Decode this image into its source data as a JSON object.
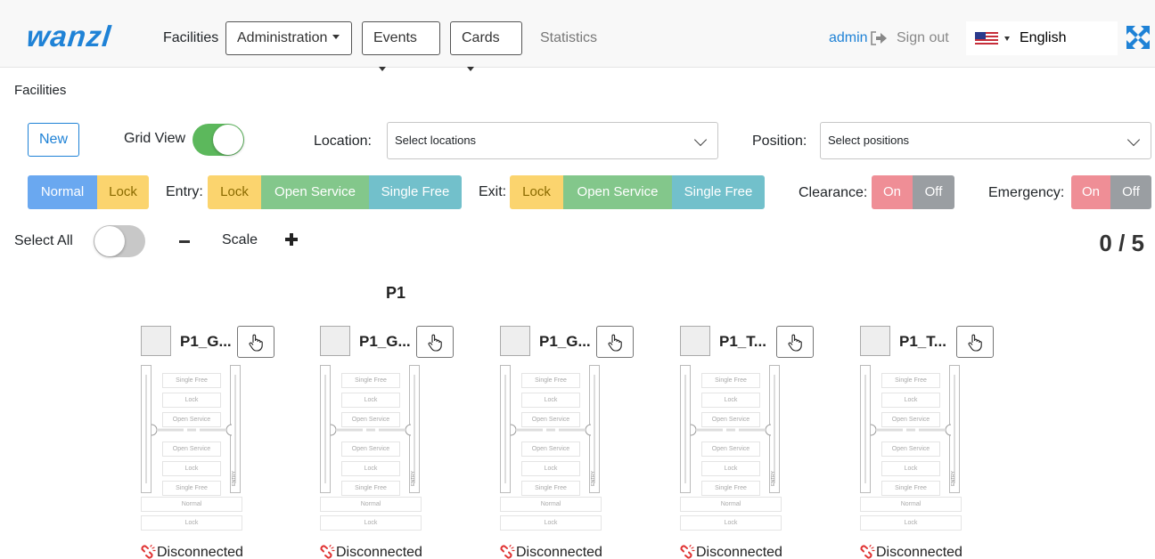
{
  "brand": {
    "logo": "wanzl"
  },
  "nav": {
    "facilities": "Facilities",
    "administration": "Administration",
    "events": "Events",
    "cards": "Cards",
    "statistics": "Statistics",
    "user": "admin",
    "sign_out": "Sign out",
    "language": "English"
  },
  "page": {
    "breadcrumb": "Facilities",
    "new_button": "New",
    "grid_view_label": "Grid View",
    "grid_view_on": true,
    "location_label": "Location:",
    "location_placeholder": "Select locations",
    "position_label": "Position:",
    "position_placeholder": "Select positions"
  },
  "modes": {
    "normal": "Normal",
    "lock": "Lock",
    "entry_label": "Entry:",
    "exit_label": "Exit:",
    "entry": [
      "Lock",
      "Open Service",
      "Single Free"
    ],
    "exit": [
      "Lock",
      "Open Service",
      "Single Free"
    ],
    "clearance_label": "Clearance:",
    "emergency_label": "Emergency:",
    "on": "On",
    "off": "Off"
  },
  "controls": {
    "select_all": "Select All",
    "select_all_on": false,
    "scale": "Scale",
    "counter": "0 / 5"
  },
  "group": {
    "title": "P1"
  },
  "facilities": [
    {
      "name": "P1_G...",
      "status": "Disconnected"
    },
    {
      "name": "P1_G...",
      "status": "Disconnected"
    },
    {
      "name": "P1_G...",
      "status": "Disconnected"
    },
    {
      "name": "P1_T...",
      "status": "Disconnected"
    },
    {
      "name": "P1_T...",
      "status": "Disconnected"
    }
  ],
  "gate_labels": {
    "top": [
      "Single Free",
      "Lock",
      "Open Service"
    ],
    "bottom": [
      "Open Service",
      "Lock",
      "Single Free"
    ],
    "footer": [
      "Normal",
      "Lock"
    ],
    "entry": "ENTRY"
  },
  "colors": {
    "brand": "#1f82d6",
    "normal": "#6aa8f0",
    "lock": "#fbd46e",
    "open_service": "#83c78b",
    "single_free": "#72c0cb",
    "on": "#ef8e96",
    "off": "#9a9ea2",
    "toggle_on": "#5cb85c"
  },
  "icons": {
    "sign_out": "sign-out-icon",
    "flag": "us-flag-icon",
    "fullscreen": "fullscreen-icon",
    "hand": "pointer-hand-icon",
    "disconnected": "broken-link-icon"
  }
}
